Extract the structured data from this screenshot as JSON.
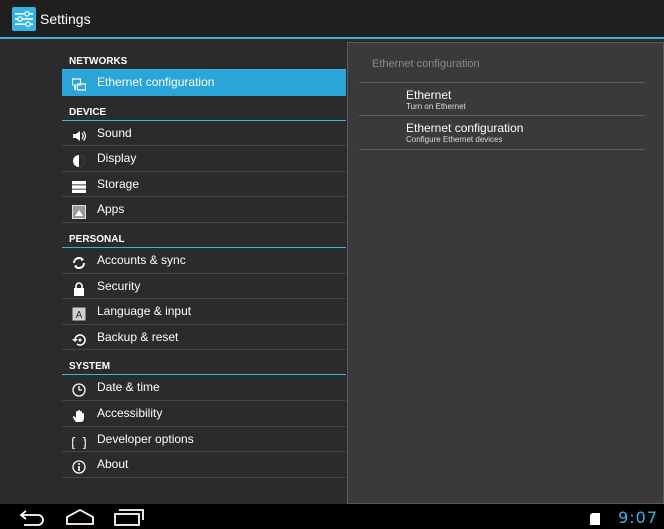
{
  "app": {
    "title": "Settings"
  },
  "colors": {
    "accent": "#33b5e5",
    "selected": "#2aa5da",
    "background": "#2b2b2b",
    "pane": "#3a3a3a"
  },
  "sidebar": {
    "categories": [
      {
        "label": "NETWORKS",
        "items": [
          {
            "label": "Ethernet configuration",
            "icon": "ethernet-icon",
            "selected": true
          }
        ]
      },
      {
        "label": "DEVICE",
        "items": [
          {
            "label": "Sound",
            "icon": "sound-icon"
          },
          {
            "label": "Display",
            "icon": "display-icon"
          },
          {
            "label": "Storage",
            "icon": "storage-icon"
          },
          {
            "label": "Apps",
            "icon": "apps-icon"
          }
        ]
      },
      {
        "label": "PERSONAL",
        "items": [
          {
            "label": "Accounts & sync",
            "icon": "sync-icon"
          },
          {
            "label": "Security",
            "icon": "lock-icon"
          },
          {
            "label": "Language & input",
            "icon": "language-icon"
          },
          {
            "label": "Backup & reset",
            "icon": "backup-icon"
          }
        ]
      },
      {
        "label": "SYSTEM",
        "items": [
          {
            "label": "Date & time",
            "icon": "clock-icon"
          },
          {
            "label": "Accessibility",
            "icon": "hand-icon"
          },
          {
            "label": "Developer options",
            "icon": "braces-icon"
          },
          {
            "label": "About",
            "icon": "info-icon"
          }
        ]
      }
    ]
  },
  "detail": {
    "header": "Ethernet configuration",
    "prefs": [
      {
        "title": "Ethernet",
        "summary": "Turn on Ethernet"
      },
      {
        "title": "Ethernet configuration",
        "summary": "Configure Ethernet devices"
      }
    ]
  },
  "statusbar": {
    "time": "9:07"
  }
}
